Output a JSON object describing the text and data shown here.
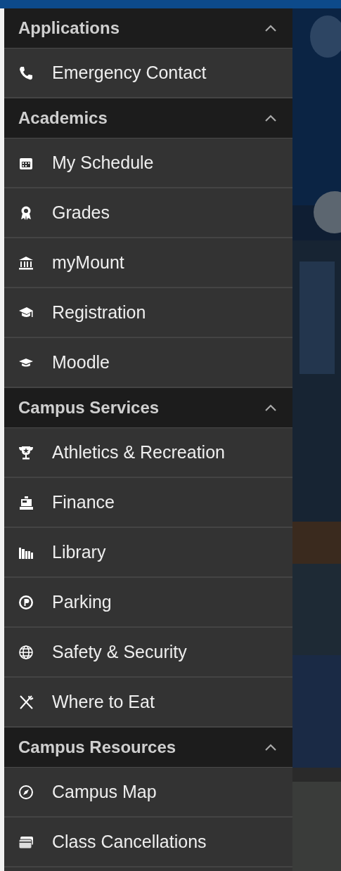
{
  "sections": [
    {
      "title": "Applications",
      "expanded": true,
      "items": [
        {
          "label": "Emergency Contact"
        }
      ]
    },
    {
      "title": "Academics",
      "expanded": true,
      "items": [
        {
          "label": "My Schedule"
        },
        {
          "label": "Grades"
        },
        {
          "label": "myMount"
        },
        {
          "label": "Registration"
        },
        {
          "label": "Moodle"
        }
      ]
    },
    {
      "title": "Campus Services",
      "expanded": true,
      "items": [
        {
          "label": "Athletics & Recreation"
        },
        {
          "label": "Finance"
        },
        {
          "label": "Library"
        },
        {
          "label": "Parking"
        },
        {
          "label": "Safety & Security"
        },
        {
          "label": "Where to Eat"
        }
      ]
    },
    {
      "title": "Campus Resources",
      "expanded": true,
      "items": [
        {
          "label": "Campus Map"
        },
        {
          "label": "Class Cancellations"
        }
      ]
    }
  ]
}
